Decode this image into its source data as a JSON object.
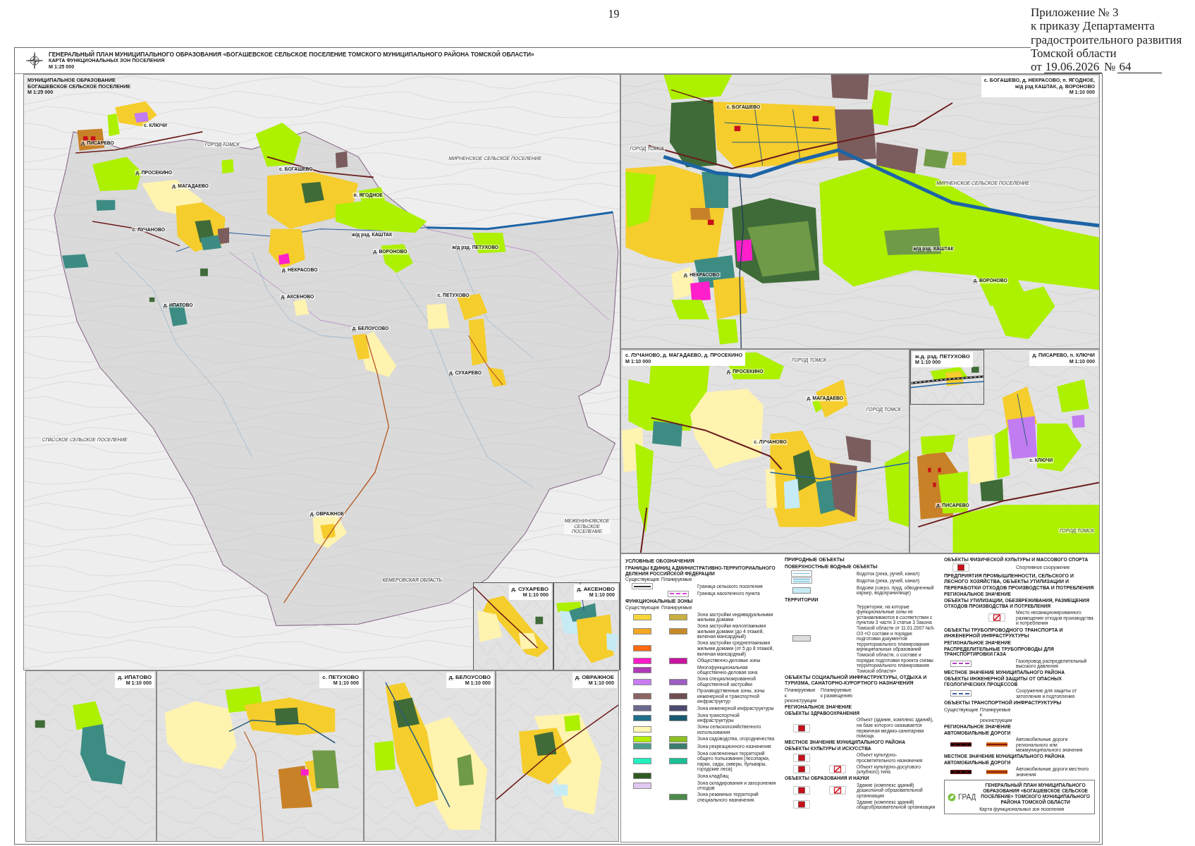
{
  "page_number": "19",
  "order_header": {
    "appendix": "Приложение № 3\nк приказу Департамента\nградостроительного развития\nТомской области",
    "date_prefix": "от",
    "date": "19.06.2026",
    "number_prefix": "№",
    "number": "64"
  },
  "sheet": {
    "title": "ГЕНЕРАЛЬНЫЙ ПЛАН МУНИЦИПАЛЬНОГО ОБРАЗОВАНИЯ «БОГАШЕВСКОЕ СЕЛЬСКОЕ ПОСЕЛЕНИЕ ТОМСКОГО МУНИЦИПАЛЬНОГО РАЙОНА ТОМСКОЙ ОБЛАСТИ»",
    "subtitle": "КАРТА ФУНКЦИОНАЛЬНЫХ ЗОН ПОСЕЛЕНИЯ",
    "scale": "М 1:25 000"
  },
  "maps": [
    {
      "title": "МУНИЦИПАЛЬНОЕ ОБРАЗОВАНИЕ\nБОГАШЕВСКОЕ СЕЛЬСКОЕ ПОСЕЛЕНИЕ",
      "scale": "М 1:25 000",
      "labels": [
        {
          "text": "с. КЛЮЧИ",
          "kind": "settlement"
        },
        {
          "text": "д. ПИСАРЕВО",
          "kind": "settlement"
        },
        {
          "text": "ГОРОД ТОМСК",
          "kind": "area"
        },
        {
          "text": "МИРНЕНСКОЕ СЕЛЬСКОЕ ПОСЕЛЕНИЕ",
          "kind": "area"
        },
        {
          "text": "д. ПРОСЕКИНО",
          "kind": "settlement"
        },
        {
          "text": "с. БОГАШЕВО",
          "kind": "settlement"
        },
        {
          "text": "д. МАГАДАЕВО",
          "kind": "settlement"
        },
        {
          "text": "п. ЯГОДНОЕ",
          "kind": "settlement"
        },
        {
          "text": "с. ЛУЧАНОВО",
          "kind": "settlement"
        },
        {
          "text": "ж/д рзд. КАШТАК",
          "kind": "settlement"
        },
        {
          "text": "ж/д рзд. ПЕТУХОВО",
          "kind": "settlement"
        },
        {
          "text": "д. ВОРОНОВО",
          "kind": "settlement"
        },
        {
          "text": "д. НЕКРАСОВО",
          "kind": "settlement"
        },
        {
          "text": "с. ПЕТУХОВО",
          "kind": "settlement"
        },
        {
          "text": "д. АКСЕНОВО",
          "kind": "settlement"
        },
        {
          "text": "д. ИПАТОВО",
          "kind": "settlement"
        },
        {
          "text": "д. БЕЛОУСОВО",
          "kind": "settlement"
        },
        {
          "text": "д. СУХАРЕВО",
          "kind": "settlement"
        },
        {
          "text": "СПАССКОЕ СЕЛЬСКОЕ ПОСЕЛЕНИЕ",
          "kind": "area"
        },
        {
          "text": "д. ОВРАЖНОЕ",
          "kind": "settlement"
        },
        {
          "text": "МЕЖЕНИНОВСКОЕ\nСЕЛЬСКОЕ\nПОСЕЛЕНИЕ",
          "kind": "area"
        },
        {
          "text": "КЕМЕРОВСКАЯ ОБЛАСТЬ",
          "kind": "area"
        }
      ]
    },
    {
      "title": "с. БОГАШЕВО, д. НЕКРАСОВО, п. ЯГОДНОЕ,\nж/д рзд КАШТАК, д. ВОРОНОВО",
      "scale": "М 1:10 000",
      "labels": [
        {
          "text": "с. БОГАШЕВО",
          "kind": "settlement"
        },
        {
          "text": "ГОРОД ТОМСК",
          "kind": "area"
        },
        {
          "text": "МИРНЕНСКОЕ СЕЛЬСКОЕ ПОСЕЛЕНИЕ",
          "kind": "area"
        },
        {
          "text": "ж/д рзд. КАШТАК",
          "kind": "settlement"
        },
        {
          "text": "д. НЕКРАСОВО",
          "kind": "settlement"
        },
        {
          "text": "д. ВОРОНОВО",
          "kind": "settlement"
        }
      ]
    },
    {
      "title": "с. ЛУЧАНОВО, д. МАГАДАЕВО, д. ПРОСЕКИНО",
      "scale": "М 1:10 000",
      "labels": [
        {
          "text": "ГОРОД ТОМСК",
          "kind": "area"
        },
        {
          "text": "д. ПРОСЕКИНО",
          "kind": "settlement"
        },
        {
          "text": "д. МАГАДАЕВО",
          "kind": "settlement"
        },
        {
          "text": "ГОРОД ТОМСК",
          "kind": "area"
        },
        {
          "text": "с. ЛУЧАНОВО",
          "kind": "settlement"
        }
      ]
    },
    {
      "title": "д. СУХАРЕВО",
      "scale": "М 1:10 000"
    },
    {
      "title": "д. АКСЕНОВО",
      "scale": "М 1:10 000"
    },
    {
      "title": "ж.д. рзд. ПЕТУХОВО",
      "scale": "М 1:10 000"
    },
    {
      "title": "д. ПИСАРЕВО, п. КЛЮЧИ",
      "scale": "М 1:10 000",
      "labels": [
        {
          "text": "с. КЛЮЧИ",
          "kind": "settlement"
        },
        {
          "text": "д. ПИСАРЕВО",
          "kind": "settlement"
        },
        {
          "text": "ГОРОД ТОМСК",
          "kind": "area"
        }
      ]
    },
    {
      "title": "д. ИПАТОВО",
      "scale": "М 1:10 000"
    },
    {
      "title": "с. ПЕТУХОВО",
      "scale": "М 1:10 000"
    },
    {
      "title": "д. БЕЛОУСОВО",
      "scale": "М 1:10 000"
    },
    {
      "title": "д. ОВРАЖНОЕ",
      "scale": "М 1:10 000"
    }
  ],
  "legend": {
    "items": [
      {
        "kind": "heading",
        "text": "УСЛОВНЫЕ ОБОЗНАЧЕНИЯ"
      },
      {
        "kind": "subheading",
        "text": "ГРАНИЦЫ ЕДИНИЦ АДМИНИСТРАТИВНО-ТЕРРИТОРИАЛЬНОГО ДЕЛЕНИЯ РОССИЙСКОЙ ФЕДЕРАЦИИ"
      },
      {
        "kind": "column_heads",
        "texts": [
          "Существующие",
          "Планируемые"
        ]
      },
      {
        "kind": "boundary",
        "planned": false,
        "color": "#333333",
        "text": "Граница сельского поселения"
      },
      {
        "kind": "boundary",
        "planned": true,
        "color": "#e040e0",
        "text": "Граница населенного пункта"
      },
      {
        "kind": "heading",
        "text": "ФУНКЦИОНАЛЬНЫЕ ЗОНЫ"
      },
      {
        "kind": "column_heads",
        "texts": [
          "Существующие",
          "Планируемые"
        ]
      },
      {
        "kind": "zone",
        "existing": {
          "color": "#f7d63a"
        },
        "planned": {
          "color": "#c9b040"
        },
        "text": "Зона застройки индивидуальными жилыми домами"
      },
      {
        "kind": "zone",
        "existing": {
          "color": "#f5a623"
        },
        "planned": {
          "color": "#c88a28"
        },
        "text": "Зона застройки малоэтажными жилыми домами (до 4 этажей, включая мансардный)"
      },
      {
        "kind": "zone",
        "existing": {
          "color": "#ff6a13"
        },
        "text": "Зона застройки среднеэтажными жилыми домами (от 5 до 8 этажей, включая мансардный)"
      },
      {
        "kind": "zone",
        "existing": {
          "color": "#ff1cc8"
        },
        "planned": {
          "color": "#c8149e"
        },
        "text": "Общественно-деловые зоны"
      },
      {
        "kind": "zone",
        "existing": {
          "color": "#b03ab8"
        },
        "text": "Многофункциональная общественно-деловая зона"
      },
      {
        "kind": "zone",
        "existing": {
          "color": "#c77cf0"
        },
        "planned": {
          "color": "#9a5fc0"
        },
        "text": "Зона специализированной общественной застройки"
      },
      {
        "kind": "zone",
        "existing": {
          "color": "#8b6464"
        },
        "planned": {
          "color": "#6e4e4e"
        },
        "text": "Производственные зоны, зоны инженерной и транспортной инфраструктур"
      },
      {
        "kind": "zone",
        "existing": {
          "color": "#6a6a8e"
        },
        "planned": {
          "color": "#4c4c70"
        },
        "text": "Зона инженерной инфраструктуры"
      },
      {
        "kind": "zone",
        "existing": {
          "color": "#1f6f8b"
        },
        "planned": {
          "color": "#195a70"
        },
        "text": "Зона транспортной инфраструктуры"
      },
      {
        "kind": "zone",
        "existing": {
          "color": "#fff7b3"
        },
        "text": "Зоны сельскохозяйственного использования"
      },
      {
        "kind": "zone",
        "existing": {
          "color": "#b0f000"
        },
        "planned": {
          "color": "#8bc020"
        },
        "text": "Зона садоводства, огородничества"
      },
      {
        "kind": "zone",
        "existing": {
          "color": "#4e9c8c"
        },
        "planned": {
          "color": "#3c7c6e"
        },
        "text": "Зона рекреационного назначения"
      },
      {
        "kind": "zone",
        "existing": {
          "color": "#22f0c0"
        },
        "planned": {
          "color": "#1cc098"
        },
        "text": "Зона озелененных территорий общего пользования (лесопарки, парки, сады, скверы, бульвары, городские леса)"
      },
      {
        "kind": "zone",
        "existing": {
          "color": "#2f5a22"
        },
        "text": "Зона кладбищ"
      },
      {
        "kind": "zone",
        "existing": {
          "color": "#e0c8f0"
        },
        "text": "Зона складирования и захоронения отходов"
      },
      {
        "kind": "zone",
        "planned": {
          "color": "#4c8a4c"
        },
        "text": "Зона режимных территорий специального назначения"
      },
      {
        "kind": "heading",
        "text": "ПРИРОДНЫЕ ОБЪЕКТЫ"
      },
      {
        "kind": "subheading",
        "text": "ПОВЕРХНОСТНЫЕ ВОДНЫЕ ОБЪЕКТЫ"
      },
      {
        "kind": "water_line",
        "text": "Водоток (река, ручей, канал)"
      },
      {
        "kind": "water_band",
        "text": "Водоток (река, ручей, канал)"
      },
      {
        "kind": "water_area",
        "text": "Водоем (озеро, пруд, обводненный карьер, водохранилище)"
      },
      {
        "kind": "heading",
        "text": "ТЕРРИТОРИИ"
      },
      {
        "kind": "zone",
        "existing": {
          "color": "#dddddd"
        },
        "text": "Территории, на которые функциональные зоны не устанавливаются в соответствии с пунктом 3 части 3 статьи 3 Закона Томской области от 11.01.2007 №9-ОЗ «О составе и порядке подготовки документов территориального планирования муниципальных образований Томской области, о составе и порядке подготовки проекта схемы территориального планирования Томской области»"
      },
      {
        "kind": "heading",
        "text": "ОБЪЕКТЫ СОЦИАЛЬНОЙ ИНФРАСТРУКТУРЫ, ОТДЫХА И ТУРИЗМА, САНАТОРНО-КУРОРТНОГО НАЗНАЧЕНИЯ"
      },
      {
        "kind": "column_heads",
        "texts": [
          "Планируемые к реконструкции",
          "Планируемые к размещению"
        ]
      },
      {
        "kind": "subheading",
        "text": "РЕГИОНАЛЬНОЕ ЗНАЧЕНИЕ"
      },
      {
        "kind": "subheading",
        "text": "ОБЪЕКТЫ ЗДРАВООХРАНЕНИЯ"
      },
      {
        "kind": "symbol",
        "reconstruction": true,
        "placement": false,
        "text": "Объект (здание, комплекс зданий), на базе которого оказывается первичная медико-санитарная помощь"
      },
      {
        "kind": "subheading",
        "text": "МЕСТНОЕ ЗНАЧЕНИЕ МУНИЦИПАЛЬНОГО РАЙОНА"
      },
      {
        "kind": "subheading",
        "text": "ОБЪЕКТЫ КУЛЬТУРЫ И ИСКУССТВА"
      },
      {
        "kind": "symbol",
        "reconstruction": true,
        "placement": false,
        "text": "Объект культурно-просветительного назначения"
      },
      {
        "kind": "symbol",
        "reconstruction": true,
        "placement": true,
        "text": "Объект культурно-досугового (клубного) типа"
      },
      {
        "kind": "subheading",
        "text": "ОБЪЕКТЫ ОБРАЗОВАНИЯ И НАУКИ"
      },
      {
        "kind": "symbol",
        "reconstruction": true,
        "placement": true,
        "text": "Здание (комплекс зданий) дошкольной образовательной организации"
      },
      {
        "kind": "symbol",
        "reconstruction": true,
        "placement": false,
        "text": "Здание (комплекс зданий) общеобразовательной организации"
      },
      {
        "kind": "subheading",
        "text": "ОБЪЕКТЫ ФИЗИЧЕСКОЙ КУЛЬТУРЫ И МАССОВОГО СПОРТА"
      },
      {
        "kind": "symbol",
        "reconstruction": true,
        "placement": false,
        "text": "Спортивное сооружение"
      },
      {
        "kind": "heading",
        "text": "ПРЕДПРИЯТИЯ ПРОМЫШЛЕННОСТИ, СЕЛЬСКОГО И ЛЕСНОГО ХОЗЯЙСТВА, ОБЪЕКТЫ УТИЛИЗАЦИИ И ПЕРЕРАБОТКИ ОТХОДОВ ПРОИЗВОДСТВА И ПОТРЕБЛЕНИЯ"
      },
      {
        "kind": "subheading",
        "text": "РЕГИОНАЛЬНОЕ ЗНАЧЕНИЕ"
      },
      {
        "kind": "subheading",
        "text": "ОБЪЕКТЫ УТИЛИЗАЦИИ, ОБЕЗВРЕЖИВАНИЯ, РАЗМЕЩЕНИЯ ОТХОДОВ ПРОИЗВОДСТВА И ПОТРЕБЛЕНИЯ"
      },
      {
        "kind": "symbol",
        "reconstruction": false,
        "placement": true,
        "text": "Место несанкционированного размещения отходов производства и потребления"
      },
      {
        "kind": "heading",
        "text": "ОБЪЕКТЫ ТРУБОПРОВОДНОГО ТРАНСПОРТА И ИНЖЕНЕРНОЙ ИНФРАСТРУКТУРЫ"
      },
      {
        "kind": "subheading",
        "text": "РЕГИОНАЛЬНОЕ ЗНАЧЕНИЕ"
      },
      {
        "kind": "subheading",
        "text": "РАСПРЕДЕЛИТЕЛЬНЫЕ ТРУБОПРОВОДЫ ДЛЯ ТРАНСПОРТИРОВКИ ГАЗА"
      },
      {
        "kind": "line",
        "color": "#b040c0",
        "text": "Газопровод распределительный высокого давления"
      },
      {
        "kind": "subheading",
        "text": "МЕСТНОЕ ЗНАЧЕНИЕ МУНИЦИПАЛЬНОГО РАЙОНА"
      },
      {
        "kind": "subheading",
        "text": "ОБЪЕКТЫ ИНЖЕНЕРНОЙ ЗАЩИТЫ ОТ ОПАСНЫХ ГЕОЛОГИЧЕСКИХ ПРОЦЕССОВ"
      },
      {
        "kind": "line",
        "color": "#4060a0",
        "text": "Сооружение для защиты от затопления и подтопления"
      },
      {
        "kind": "heading",
        "text": "ОБЪЕКТЫ ТРАНСПОРТНОЙ ИНФРАСТРУКТУРЫ"
      },
      {
        "kind": "column_heads",
        "texts": [
          "Существующие",
          "Планируемые к реконструкции"
        ]
      },
      {
        "kind": "subheading",
        "text": "РЕГИОНАЛЬНОЕ ЗНАЧЕНИЕ"
      },
      {
        "kind": "subheading",
        "text": "АВТОМОБИЛЬНЫЕ ДОРОГИ"
      },
      {
        "kind": "road",
        "existing": {
          "color": "#5a1010"
        },
        "planned": {
          "color": "#d07020"
        },
        "text": "Автомобильные дороги регионального или межмуниципального значения"
      },
      {
        "kind": "subheading",
        "text": "МЕСТНОЕ ЗНАЧЕНИЕ МУНИЦИПАЛЬНОГО РАЙОНА"
      },
      {
        "kind": "subheading",
        "text": "АВТОМОБИЛЬНЫЕ ДОРОГИ"
      },
      {
        "kind": "road",
        "existing": {
          "color": "#5a1010"
        },
        "planned": {
          "color": "#d07020"
        },
        "text": "Автомобильные дороги местного значения"
      }
    ]
  },
  "stamp": {
    "logo": "ГРАД",
    "title": "ГЕНЕРАЛЬНЫЙ ПЛАН МУНИЦИПАЛЬНОГО ОБРАЗОВАНИЯ «БОГАШЕВСКОЕ СЕЛЬСКОЕ ПОСЕЛЕНИЕ» ТОМСКОГО МУНИЦИПАЛЬНОГО РАЙОНА ТОМСКОЙ ОБЛАСТИ",
    "sheet_name": "Карта функциональных зон поселения"
  }
}
